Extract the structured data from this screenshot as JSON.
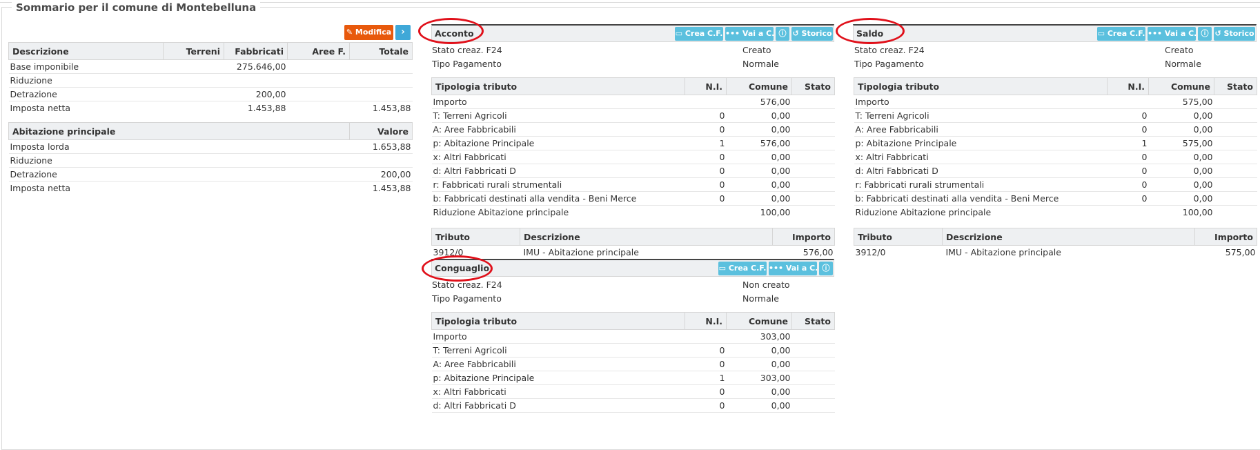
{
  "page": {
    "title": "Sommario per il comune di Montebelluna"
  },
  "summary": {
    "modifica_label": "Modifica",
    "next_icon": "chevron-right-icon",
    "table1": {
      "headers": [
        "Descrizione",
        "Terreni",
        "Fabbricati",
        "Aree F.",
        "Totale"
      ],
      "rows": [
        [
          "Base imponibile",
          "",
          "275.646,00",
          "",
          ""
        ],
        [
          "Riduzione",
          "",
          "",
          "",
          ""
        ],
        [
          "Detrazione",
          "",
          "200,00",
          "",
          ""
        ],
        [
          "Imposta netta",
          "",
          "1.453,88",
          "",
          "1.453,88"
        ]
      ]
    },
    "table2": {
      "headers": [
        "Abitazione principale",
        "Valore"
      ],
      "rows": [
        [
          "Imposta lorda",
          "1.653,88"
        ],
        [
          "Riduzione",
          ""
        ],
        [
          "Detrazione",
          "200,00"
        ],
        [
          "Imposta netta",
          "1.453,88"
        ]
      ]
    }
  },
  "acconto": {
    "title": "Acconto",
    "buttons": {
      "crea": "Crea C.F.",
      "vai": "Vai a C.F.",
      "storico": "Storico"
    },
    "stato_label": "Stato creaz. F24",
    "stato_value": "Creato",
    "tipo_label": "Tipo Pagamento",
    "tipo_value": "Normale",
    "tributi_headers": [
      "Tipologia tributo",
      "N.I.",
      "Comune",
      "Stato"
    ],
    "tributi_rows": [
      [
        "Importo",
        "",
        "576,00",
        ""
      ],
      [
        "T: Terreni Agricoli",
        "0",
        "0,00",
        ""
      ],
      [
        "A: Aree Fabbricabili",
        "0",
        "0,00",
        ""
      ],
      [
        "p: Abitazione Principale",
        "1",
        "576,00",
        ""
      ],
      [
        "x: Altri Fabbricati",
        "0",
        "0,00",
        ""
      ],
      [
        "d: Altri Fabbricati D",
        "0",
        "0,00",
        ""
      ],
      [
        "r: Fabbricati rurali strumentali",
        "0",
        "0,00",
        ""
      ],
      [
        "b: Fabbricati destinati alla vendita - Beni Merce",
        "0",
        "0,00",
        ""
      ],
      [
        "Riduzione Abitazione principale",
        "",
        "100,00",
        ""
      ]
    ],
    "codes_headers": [
      "Tributo",
      "Descrizione",
      "Importo"
    ],
    "codes_rows": [
      [
        "3912/0",
        "IMU - Abitazione principale",
        "576,00"
      ]
    ]
  },
  "saldo": {
    "title": "Saldo",
    "buttons": {
      "crea": "Crea C.F.",
      "vai": "Vai a C.F.",
      "storico": "Storico"
    },
    "stato_label": "Stato creaz. F24",
    "stato_value": "Creato",
    "tipo_label": "Tipo Pagamento",
    "tipo_value": "Normale",
    "tributi_headers": [
      "Tipologia tributo",
      "N.I.",
      "Comune",
      "Stato"
    ],
    "tributi_rows": [
      [
        "Importo",
        "",
        "575,00",
        ""
      ],
      [
        "T: Terreni Agricoli",
        "0",
        "0,00",
        ""
      ],
      [
        "A: Aree Fabbricabili",
        "0",
        "0,00",
        ""
      ],
      [
        "p: Abitazione Principale",
        "1",
        "575,00",
        ""
      ],
      [
        "x: Altri Fabbricati",
        "0",
        "0,00",
        ""
      ],
      [
        "d: Altri Fabbricati D",
        "0",
        "0,00",
        ""
      ],
      [
        "r: Fabbricati rurali strumentali",
        "0",
        "0,00",
        ""
      ],
      [
        "b: Fabbricati destinati alla vendita - Beni Merce",
        "0",
        "0,00",
        ""
      ],
      [
        "Riduzione Abitazione principale",
        "",
        "100,00",
        ""
      ]
    ],
    "codes_headers": [
      "Tributo",
      "Descrizione",
      "Importo"
    ],
    "codes_rows": [
      [
        "3912/0",
        "IMU - Abitazione principale",
        "575,00"
      ]
    ]
  },
  "conguaglio": {
    "title": "Conguaglio",
    "buttons": {
      "crea": "Crea C.F.",
      "vai": "Vai a C.F."
    },
    "stato_label": "Stato creaz. F24",
    "stato_value": "Non creato",
    "tipo_label": "Tipo Pagamento",
    "tipo_value": "Normale",
    "tributi_headers": [
      "Tipologia tributo",
      "N.I.",
      "Comune",
      "Stato"
    ],
    "tributi_rows": [
      [
        "Importo",
        "",
        "303,00",
        ""
      ],
      [
        "T: Terreni Agricoli",
        "0",
        "0,00",
        ""
      ],
      [
        "A: Aree Fabbricabili",
        "0",
        "0,00",
        ""
      ],
      [
        "p: Abitazione Principale",
        "1",
        "303,00",
        ""
      ],
      [
        "x: Altri Fabbricati",
        "0",
        "0,00",
        ""
      ],
      [
        "d: Altri Fabbricati D",
        "0",
        "0,00",
        ""
      ]
    ]
  },
  "colors": {
    "accent_blue": "#5bc0de",
    "modifica_orange": "#e8590c",
    "annotation_red": "#e0101a"
  }
}
